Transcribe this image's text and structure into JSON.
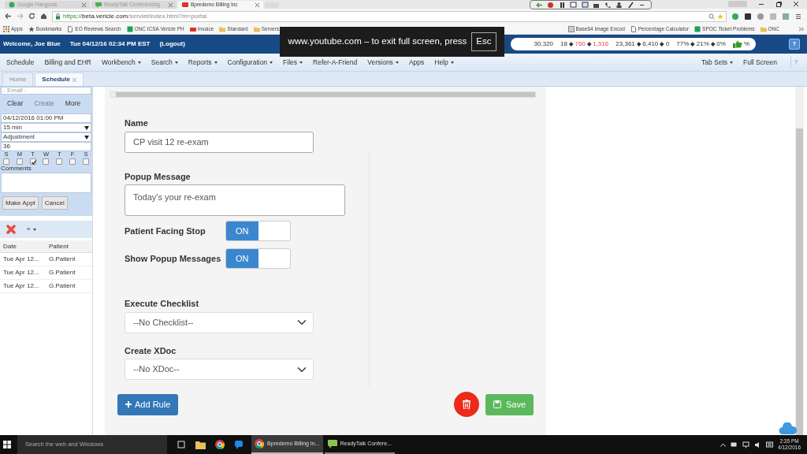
{
  "browser": {
    "tabs": [
      {
        "title": "Google Hangouts",
        "kind": "hangouts",
        "selected": false
      },
      {
        "title": "ReadyTalk Conferencing",
        "kind": "chat",
        "selected": false
      },
      {
        "title": "Bpredemo Billing Inc",
        "kind": "app",
        "selected": true
      }
    ],
    "url_scheme": "https://",
    "url_host": "beta.vericle.com",
    "url_path": "/servlet/index.html?m=portal",
    "bookmarks": [
      {
        "label": "Apps",
        "kind": "apps"
      },
      {
        "label": "Bookmarks",
        "kind": "star"
      },
      {
        "label": "EO Reviews Search",
        "kind": "page"
      },
      {
        "label": "ONC ICSA Vericle PH",
        "kind": "sheet"
      },
      {
        "label": "Invoice",
        "kind": "app"
      },
      {
        "label": "Standard",
        "kind": "folder"
      },
      {
        "label": "Servers",
        "kind": "folder"
      }
    ],
    "bookmarks_right": [
      {
        "label": "Base64 Image Encod",
        "kind": "image"
      },
      {
        "label": "Percentage Calculator",
        "kind": "page"
      },
      {
        "label": "SPOC Ticket Problems",
        "kind": "sheet"
      },
      {
        "label": "ONC",
        "kind": "folder"
      }
    ]
  },
  "fullscreen_notice": {
    "message": "www.youtube.com – to exit full screen, press",
    "key": "Esc"
  },
  "header": {
    "welcome": "Welcome, Joe Blue",
    "datetime": "Tue 04/12/16 02:34 PM EST",
    "logout": "(Logout)",
    "stats": [
      [
        {
          "text": "30,320",
          "alert": false
        }
      ],
      [
        {
          "text": "18",
          "alert": false
        },
        {
          "text": "760",
          "alert": true
        },
        {
          "text": "1,516",
          "alert": true
        }
      ],
      [
        {
          "text": "23,361",
          "alert": false
        },
        {
          "text": "6,410",
          "alert": false
        },
        {
          "text": "0",
          "alert": false
        }
      ],
      [
        {
          "text": "77%",
          "alert": false
        },
        {
          "text": "21%",
          "alert": false
        },
        {
          "text": "0%",
          "alert": false
        }
      ]
    ],
    "rating": "%",
    "help": "?"
  },
  "menu": {
    "items": [
      {
        "label": "Schedule",
        "dropdown": false
      },
      {
        "label": "Billing and EHR",
        "dropdown": false
      },
      {
        "label": "Workbench",
        "dropdown": true
      },
      {
        "label": "Search",
        "dropdown": true
      },
      {
        "label": "Reports",
        "dropdown": true
      },
      {
        "label": "Configuration",
        "dropdown": true
      },
      {
        "label": "Files",
        "dropdown": true
      },
      {
        "label": "Refer-A-Friend",
        "dropdown": false
      },
      {
        "label": "Versions",
        "dropdown": true
      },
      {
        "label": "Apps",
        "dropdown": false
      },
      {
        "label": "Help",
        "dropdown": true
      }
    ],
    "right_items": [
      {
        "label": "Tab Sets",
        "dropdown": true
      },
      {
        "label": "Full Screen",
        "dropdown": false
      }
    ],
    "help": "?"
  },
  "app_tabs": [
    {
      "label": "Home",
      "selected": false,
      "closable": false
    },
    {
      "label": "Schedule",
      "selected": true,
      "closable": true
    }
  ],
  "scheduler": {
    "email_placeholder": "- Email -",
    "actions": [
      {
        "label": "Clear",
        "disabled": false
      },
      {
        "label": "Create",
        "disabled": true
      },
      {
        "label": "More",
        "disabled": false
      }
    ],
    "start": "04/12/2016 01:00 PM",
    "duration": "15 min",
    "type": "Adjustment",
    "count": "36",
    "weekdays": [
      {
        "label": "S",
        "checked": false
      },
      {
        "label": "M",
        "checked": false
      },
      {
        "label": "T",
        "checked": true
      },
      {
        "label": "W",
        "checked": false
      },
      {
        "label": "T",
        "checked": false
      },
      {
        "label": "F",
        "checked": false
      },
      {
        "label": "S",
        "checked": false
      }
    ],
    "comments_label": "Comments",
    "buttons": [
      "Make Appt",
      "Cancel"
    ],
    "more_menu": "»",
    "columns": [
      "Date",
      "Patient"
    ],
    "rows": [
      [
        "Tue Apr 12...",
        "G.Patient"
      ],
      [
        "Tue Apr 12...",
        "G.Patient"
      ],
      [
        "Tue Apr 12...",
        "G.Patient"
      ]
    ]
  },
  "rule_form": {
    "name_label": "Name",
    "name_value": "CP visit 12 re-exam",
    "popup_label": "Popup Message",
    "popup_value": "Today's your re-exam",
    "toggles": [
      {
        "label": "Patient Facing Stop",
        "on": true,
        "on_text": "ON"
      },
      {
        "label": "Show Popup Messages",
        "on": true,
        "on_text": "ON"
      }
    ],
    "selects": [
      {
        "label": "Execute Checklist",
        "value": "--No Checklist--"
      },
      {
        "label": "Create XDoc",
        "value": "--No XDoc--"
      }
    ],
    "add_button": "Add Rule",
    "save_button": "Save"
  },
  "taskbar": {
    "search_placeholder": "Search the web and Windows",
    "apps": [
      {
        "label": "Bpredemo Billing In...",
        "kind": "chrome",
        "selected": true
      },
      {
        "label": "ReadyTalk Confere...",
        "kind": "chat",
        "selected": false
      }
    ],
    "time": "2:35 PM",
    "date": "4/12/2016"
  }
}
